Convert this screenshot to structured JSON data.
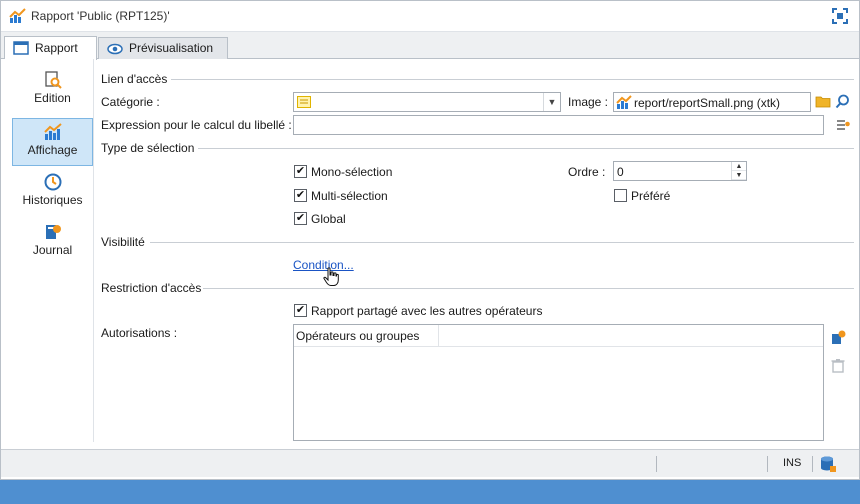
{
  "window": {
    "title": "Rapport 'Public (RPT125)'"
  },
  "tabs": [
    {
      "label": "Rapport"
    },
    {
      "label": "Prévisualisation"
    }
  ],
  "sidebar": {
    "items": [
      {
        "label": "Edition"
      },
      {
        "label": "Affichage"
      },
      {
        "label": "Historiques"
      },
      {
        "label": "Journal"
      }
    ]
  },
  "form": {
    "access_link_section": "Lien d'accès",
    "category_label": "Catégorie :",
    "category_value": "",
    "image_label": "Image :",
    "image_value": "report/reportSmall.png (xtk)",
    "expression_label": "Expression pour le calcul du libellé :",
    "expression_value": "",
    "selection_type_section": "Type de sélection",
    "mono_label": "Mono-sélection",
    "mono_checked": true,
    "multi_label": "Multi-sélection",
    "multi_checked": true,
    "global_label": "Global",
    "global_checked": true,
    "order_label": "Ordre :",
    "order_value": "0",
    "preferred_label": "Préféré",
    "preferred_checked": false,
    "visibility_section": "Visibilité",
    "condition_link": "Condition...",
    "access_restriction_section": "Restriction d'accès",
    "shared_label": "Rapport partagé avec les autres opérateurs",
    "shared_checked": true,
    "authorizations_label": "Autorisations :",
    "operators_column": "Opérateurs ou groupes"
  },
  "status": {
    "ins": "INS"
  },
  "colors": {
    "accent": "#4f8fd0",
    "link": "#1a54c4",
    "selected": "#cfe6f8"
  }
}
